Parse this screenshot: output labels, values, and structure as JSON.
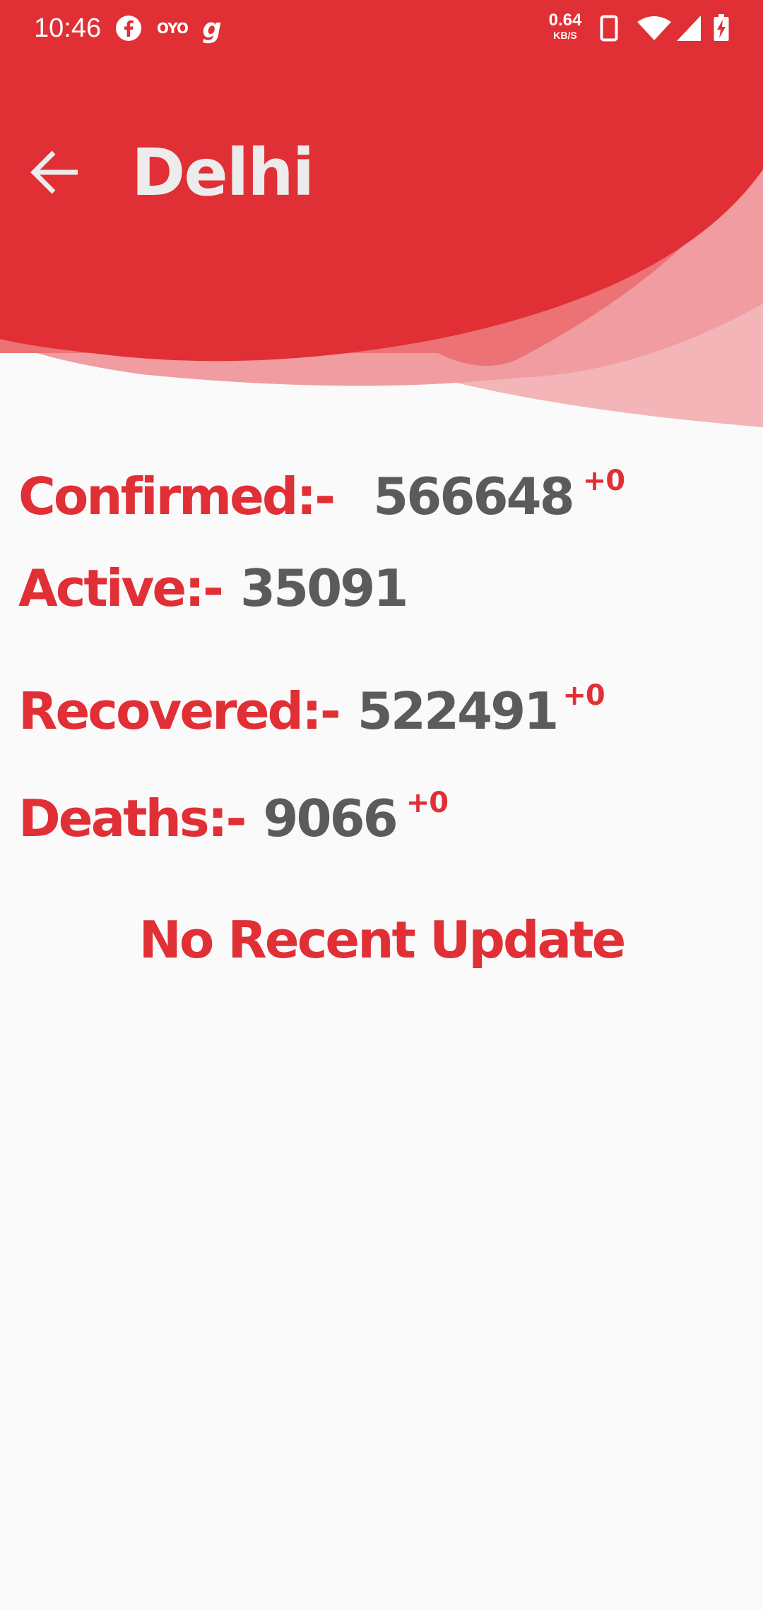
{
  "status_bar": {
    "time": "10:46",
    "notification_icons": [
      "facebook-icon",
      "oyo-icon",
      "gaana-icon"
    ],
    "oyo_text": "OYO",
    "gaana_text": "g",
    "network_speed": "0.64",
    "network_speed_unit": "KB/S",
    "system_icons": [
      "phone-icon",
      "wifi-icon",
      "cell-signal-icon",
      "battery-charging-icon"
    ]
  },
  "toolbar": {
    "back_icon": "arrow-left-icon",
    "title": "Delhi"
  },
  "stats": {
    "confirmed": {
      "label": "Confirmed:-",
      "value": "566648",
      "delta": "+0"
    },
    "active": {
      "label": "Active:-",
      "value": "35091"
    },
    "recovered": {
      "label": "Recovered:-",
      "value": "522491",
      "delta": "+0"
    },
    "deaths": {
      "label": "Deaths:-",
      "value": "9066",
      "delta": "+0"
    }
  },
  "update_message": "No Recent Update",
  "colors": {
    "primary_red": "#e02f35",
    "wave_light": "#f3b5b8",
    "wave_mid": "#ec7275",
    "title_text": "#ececec",
    "value_gray": "#5b5b5b",
    "background": "#fafafa"
  }
}
